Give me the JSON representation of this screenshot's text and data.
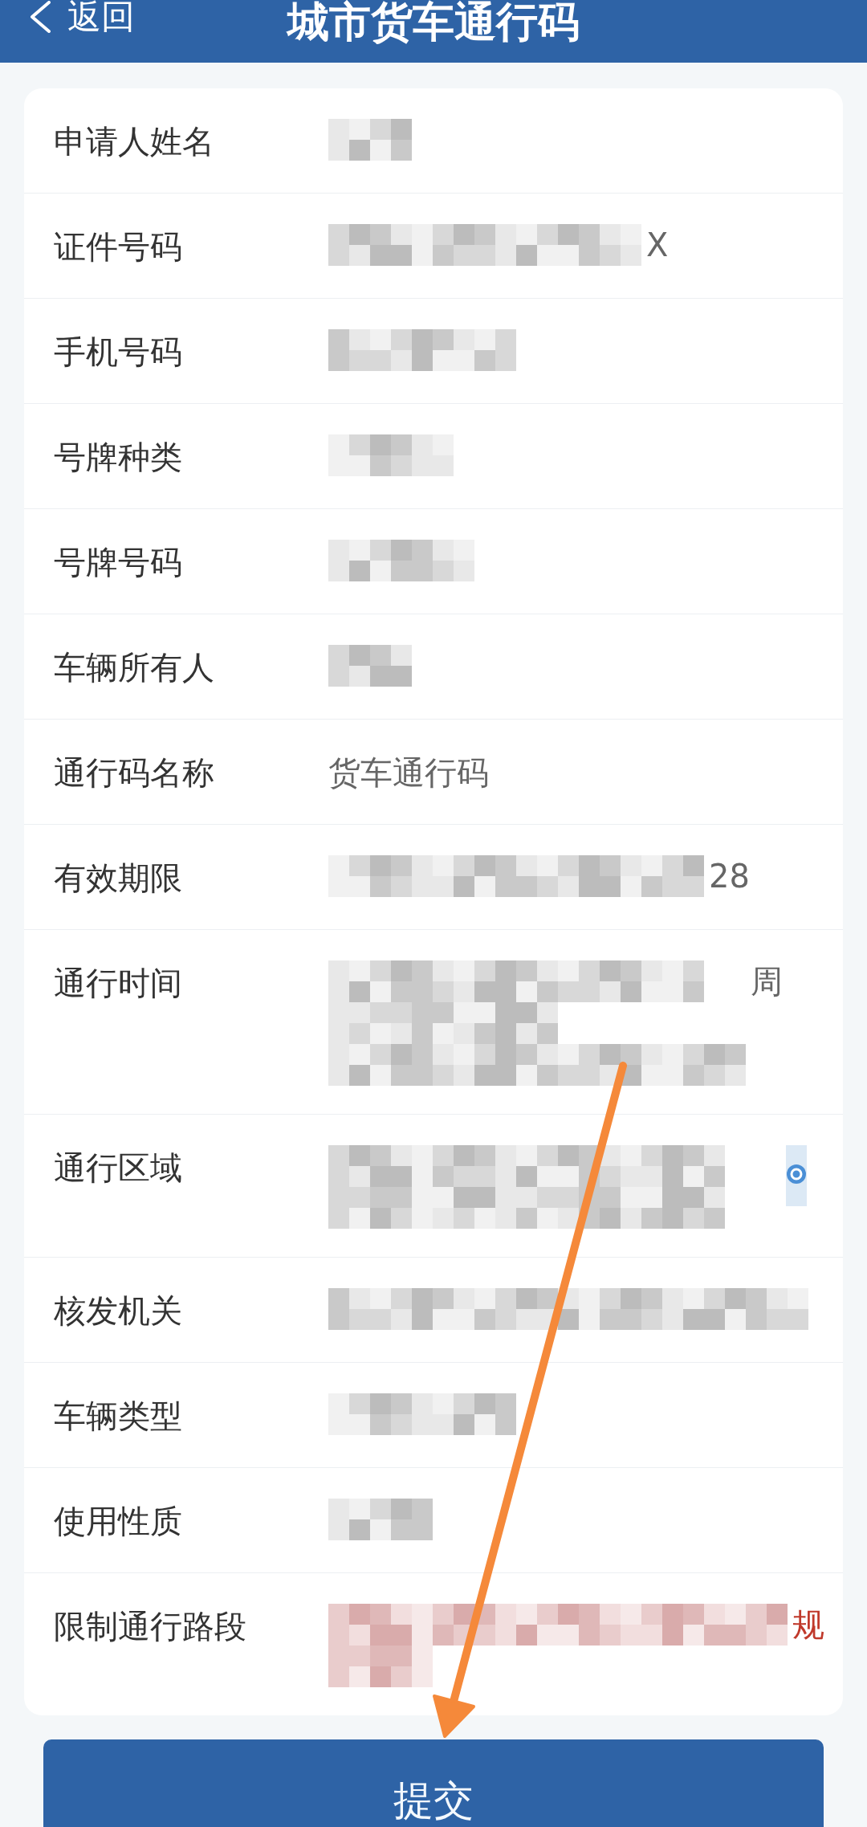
{
  "header": {
    "back_label": "返回",
    "title": "城市货车通行码"
  },
  "rows": [
    {
      "label": "申请人姓名",
      "kind": "redacted",
      "warning": false,
      "trailing_icon": false
    },
    {
      "label": "证件号码",
      "kind": "redacted",
      "visible_fragment": "X",
      "warning": false,
      "trailing_icon": false
    },
    {
      "label": "手机号码",
      "kind": "redacted",
      "warning": false,
      "trailing_icon": false
    },
    {
      "label": "号牌种类",
      "kind": "redacted",
      "warning": false,
      "trailing_icon": false
    },
    {
      "label": "号牌号码",
      "kind": "redacted",
      "warning": false,
      "trailing_icon": false
    },
    {
      "label": "车辆所有人",
      "kind": "redacted",
      "warning": false,
      "trailing_icon": false
    },
    {
      "label": "通行码名称",
      "kind": "text",
      "value": "货车通行码",
      "warning": false,
      "trailing_icon": false
    },
    {
      "label": "有效期限",
      "kind": "redacted",
      "visible_fragment": "28",
      "warning": false,
      "trailing_icon": false
    },
    {
      "label": "通行时间",
      "kind": "redacted",
      "visible_fragment": "周",
      "warning": false,
      "trailing_icon": false
    },
    {
      "label": "通行区域",
      "kind": "redacted",
      "warning": false,
      "trailing_icon": true
    },
    {
      "label": "核发机关",
      "kind": "redacted",
      "warning": false,
      "trailing_icon": false
    },
    {
      "label": "车辆类型",
      "kind": "redacted",
      "warning": false,
      "trailing_icon": false
    },
    {
      "label": "使用性质",
      "kind": "redacted",
      "warning": false,
      "trailing_icon": false
    },
    {
      "label": "限制通行路段",
      "kind": "redacted",
      "visible_fragment": "规",
      "warning": true,
      "trailing_icon": false
    }
  ],
  "submit_label": "提交"
}
